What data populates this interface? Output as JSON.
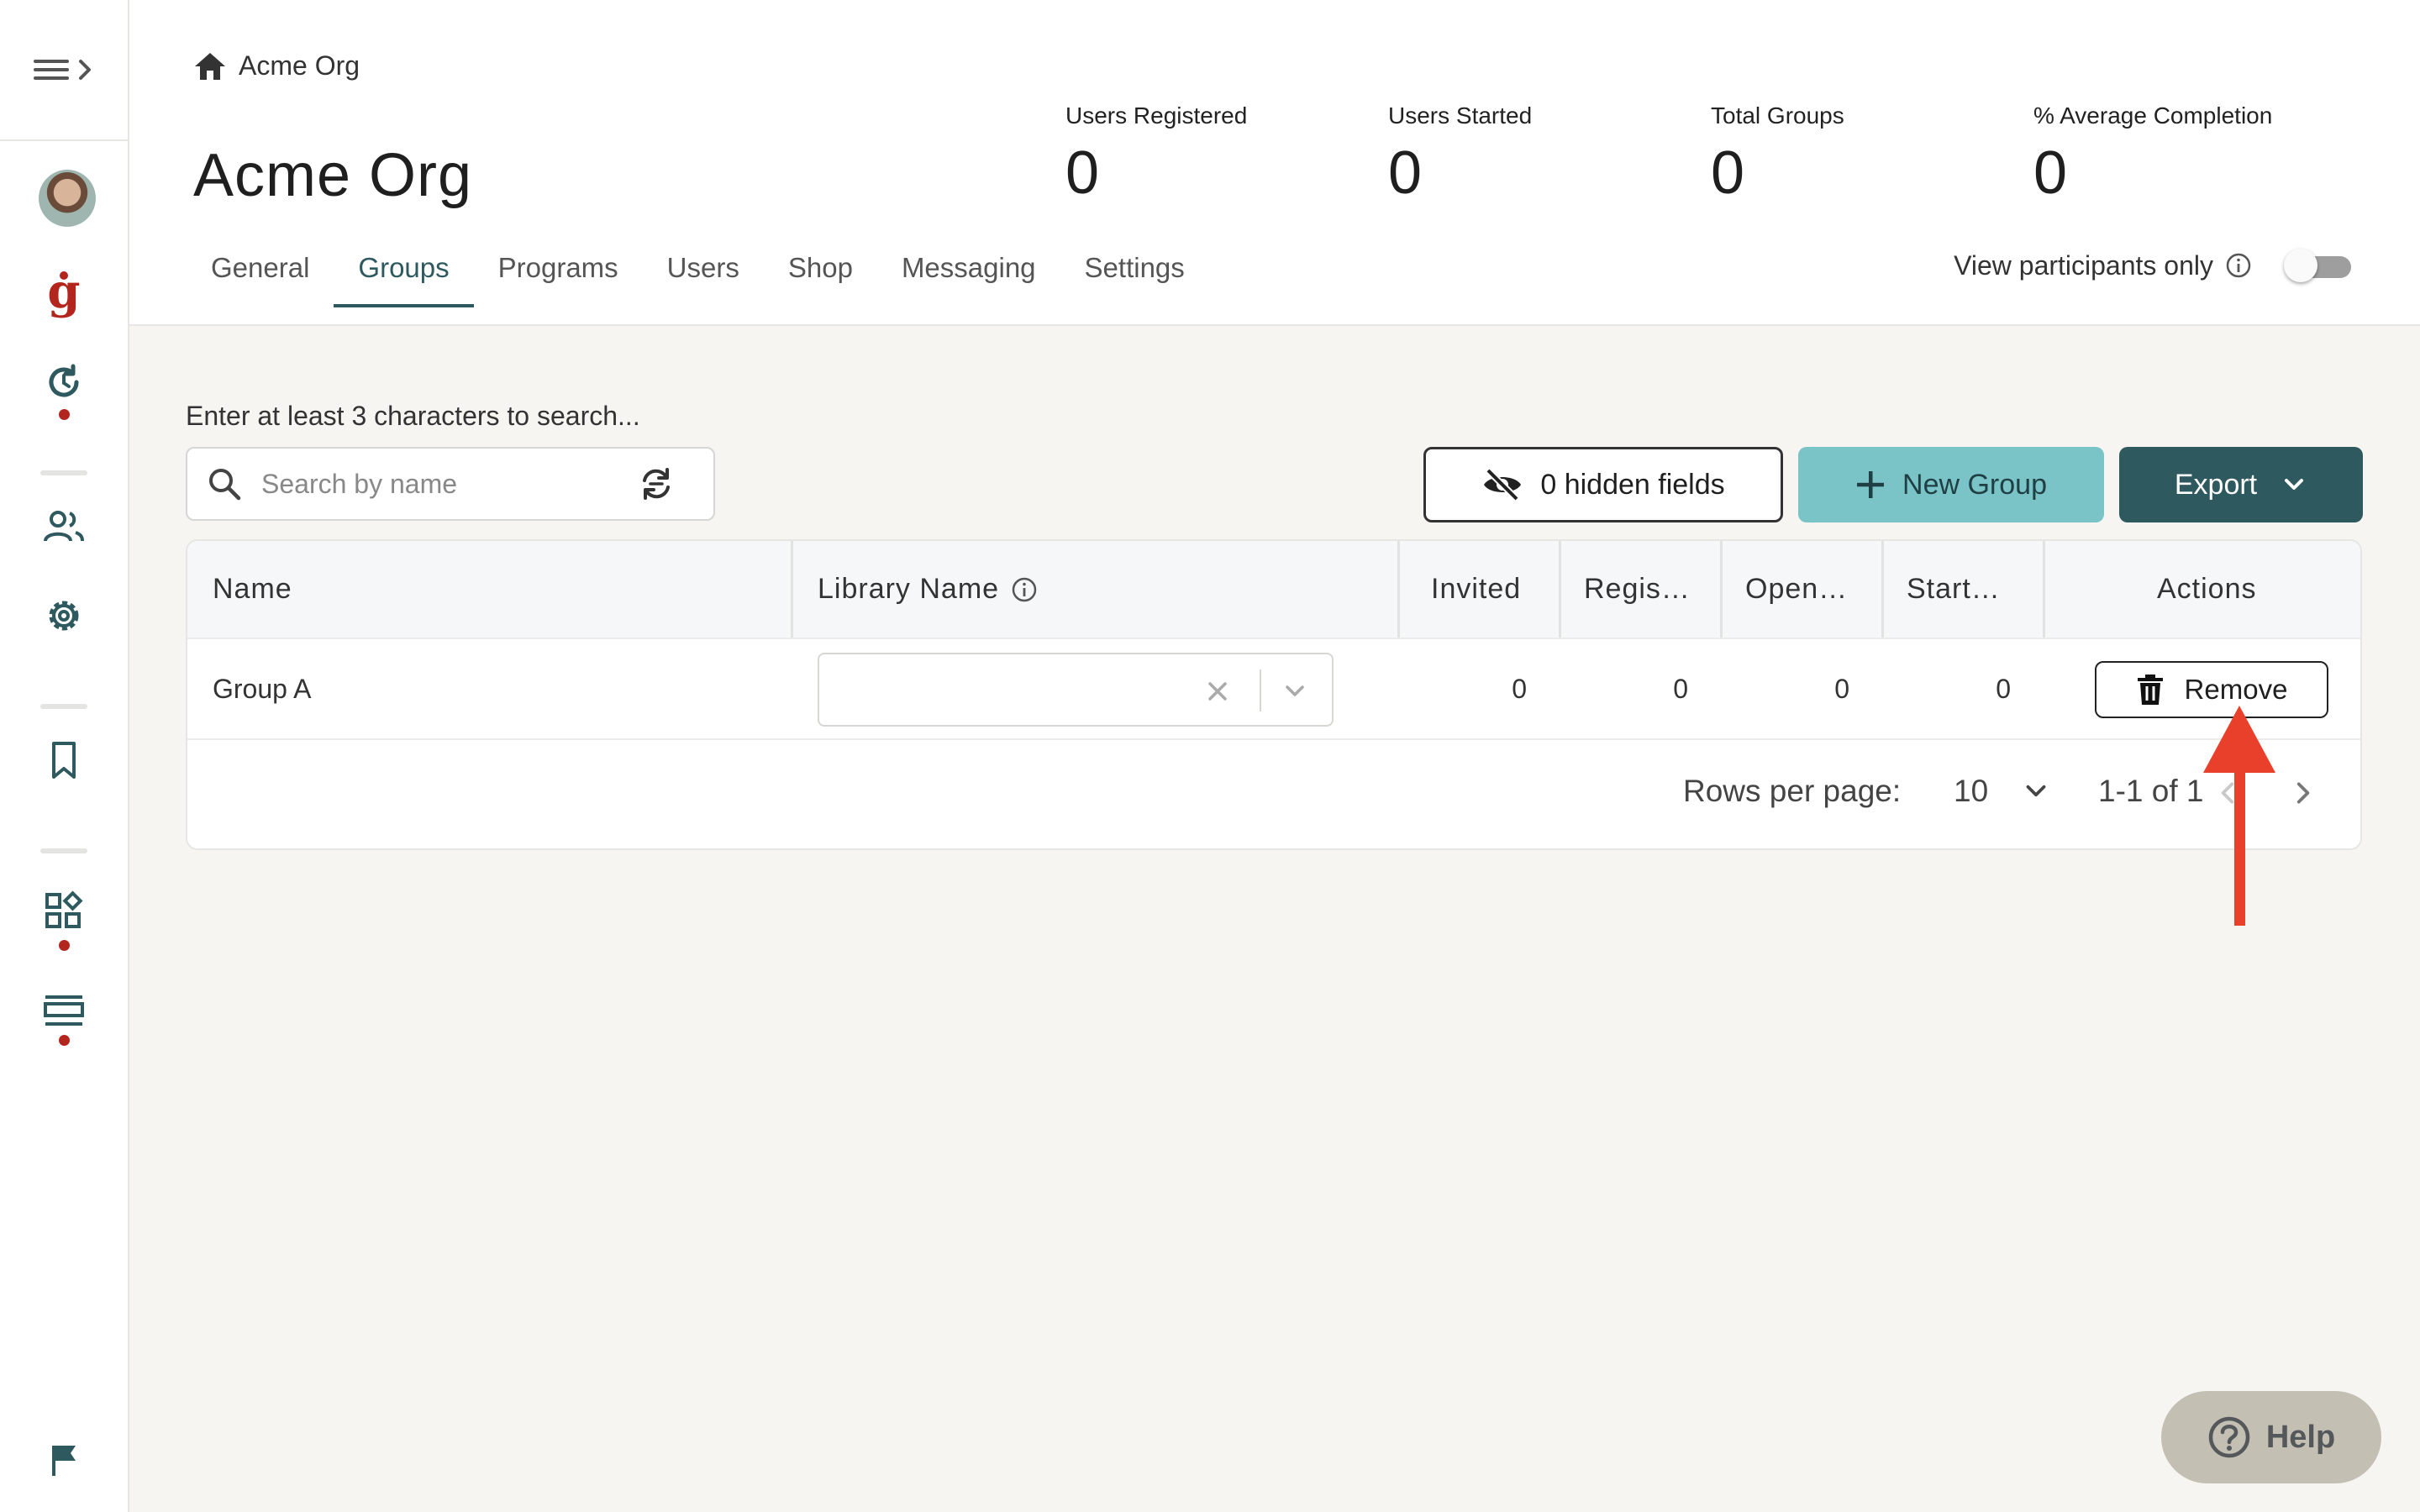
{
  "header": {
    "breadcrumb": "Acme Org",
    "page_title": "Acme Org",
    "stats": [
      {
        "label": "Users Registered",
        "value": "0"
      },
      {
        "label": "Users Started",
        "value": "0"
      },
      {
        "label": "Total Groups",
        "value": "0"
      },
      {
        "label": "% Average Completion",
        "value": "0"
      }
    ],
    "tabs": [
      {
        "label": "General"
      },
      {
        "label": "Groups",
        "active": true
      },
      {
        "label": "Programs"
      },
      {
        "label": "Users"
      },
      {
        "label": "Shop"
      },
      {
        "label": "Messaging"
      },
      {
        "label": "Settings"
      }
    ],
    "participants_toggle": {
      "label": "View participants only",
      "on": false
    }
  },
  "search": {
    "hint": "Enter at least 3 characters to search...",
    "placeholder": "Search by name",
    "value": ""
  },
  "toolbar": {
    "hidden_fields_label": "0 hidden fields",
    "new_group_label": "New Group",
    "export_label": "Export"
  },
  "table": {
    "columns": [
      "Name",
      "Library Name",
      "Invited",
      "Regis…",
      "Open…",
      "Start…",
      "Actions"
    ],
    "rows": [
      {
        "name": "Group A",
        "library_name": "",
        "invited": "0",
        "registered": "0",
        "opened": "0",
        "started": "0",
        "action_label": "Remove"
      }
    ],
    "pagination": {
      "rows_per_page_label": "Rows per page:",
      "rows_per_page_value": "10",
      "range": "1-1 of 1"
    }
  },
  "help": {
    "label": "Help"
  },
  "colors": {
    "accent_dark": "#2e5a5f",
    "accent_light": "#7ac3c6",
    "brand_red": "#b3261e",
    "annotation_arrow": "#e8402a"
  }
}
